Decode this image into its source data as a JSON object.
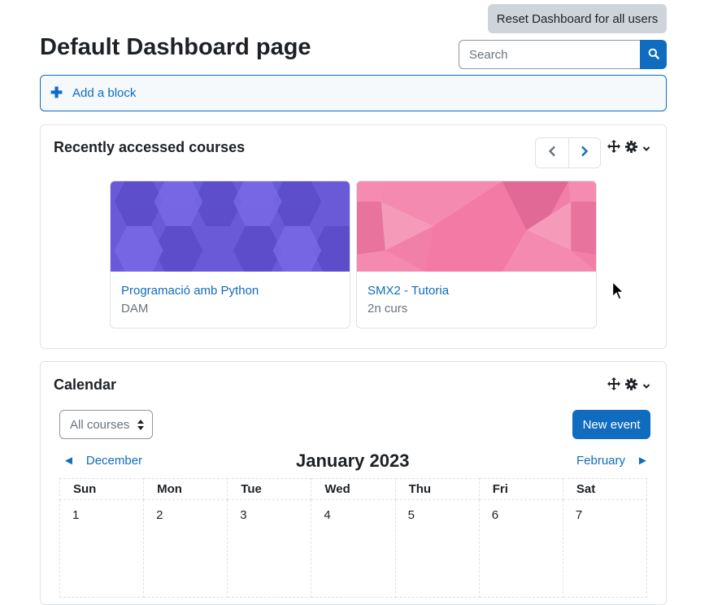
{
  "header": {
    "reset_label": "Reset Dashboard for all users",
    "title": "Default Dashboard page",
    "search_placeholder": "Search"
  },
  "add_block": {
    "label": "Add a block"
  },
  "recent_courses": {
    "title": "Recently accessed courses",
    "courses": [
      {
        "name": "Programació amb Python",
        "category": "DAM",
        "color": "#6b5ad8"
      },
      {
        "name": "SMX2 - Tutoria",
        "category": "2n curs",
        "color": "#f27fa8"
      }
    ]
  },
  "calendar": {
    "title": "Calendar",
    "course_filter": "All courses",
    "new_event_label": "New event",
    "prev_month": "December",
    "current_month": "January 2023",
    "next_month": "February",
    "weekdays": [
      "Sun",
      "Mon",
      "Tue",
      "Wed",
      "Thu",
      "Fri",
      "Sat"
    ],
    "first_week": [
      "1",
      "2",
      "3",
      "4",
      "5",
      "6",
      "7"
    ]
  },
  "colors": {
    "accent": "#0f6cbf",
    "reset_bg": "#ced4da"
  }
}
